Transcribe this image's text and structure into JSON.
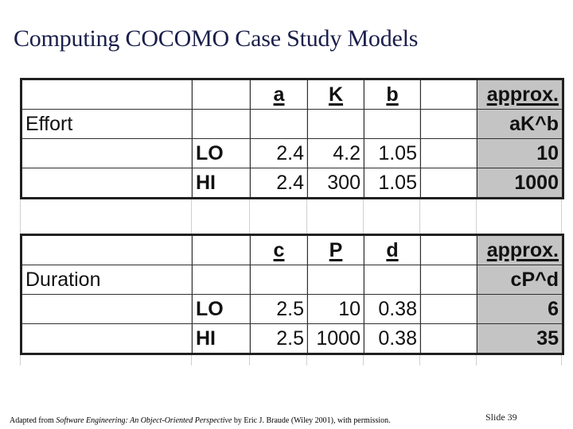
{
  "slide": {
    "title": "Computing COCOMO Case Study Models",
    "slide_number": "Slide 39"
  },
  "footer": {
    "prefix": "Adapted from ",
    "book_title": "Software Engineering: An Object-Oriented Perspective",
    "suffix": " by Eric J. Braude (Wiley 2001), with permission."
  },
  "effort_table": {
    "section_label": "Effort",
    "headers": [
      "a",
      "K",
      "b"
    ],
    "approx_header": "approx.",
    "formula": "aK^b",
    "rows": [
      {
        "label": "LO",
        "values": [
          "2.4",
          "4.2",
          "1.05"
        ],
        "approx": "10"
      },
      {
        "label": "HI",
        "values": [
          "2.4",
          "300",
          "1.05"
        ],
        "approx": "1000"
      }
    ]
  },
  "duration_table": {
    "section_label": "Duration",
    "headers": [
      "c",
      "P",
      "d"
    ],
    "approx_header": "approx.",
    "formula": "cP^d",
    "rows": [
      {
        "label": "LO",
        "values": [
          "2.5",
          "10",
          "0.38"
        ],
        "approx": "6"
      },
      {
        "label": "HI",
        "values": [
          "2.5",
          "1000",
          "0.38"
        ],
        "approx": "35"
      }
    ]
  },
  "colors": {
    "title": "#1a1f4a",
    "approx_fill": "#c4c4c4",
    "border": "#202020"
  }
}
